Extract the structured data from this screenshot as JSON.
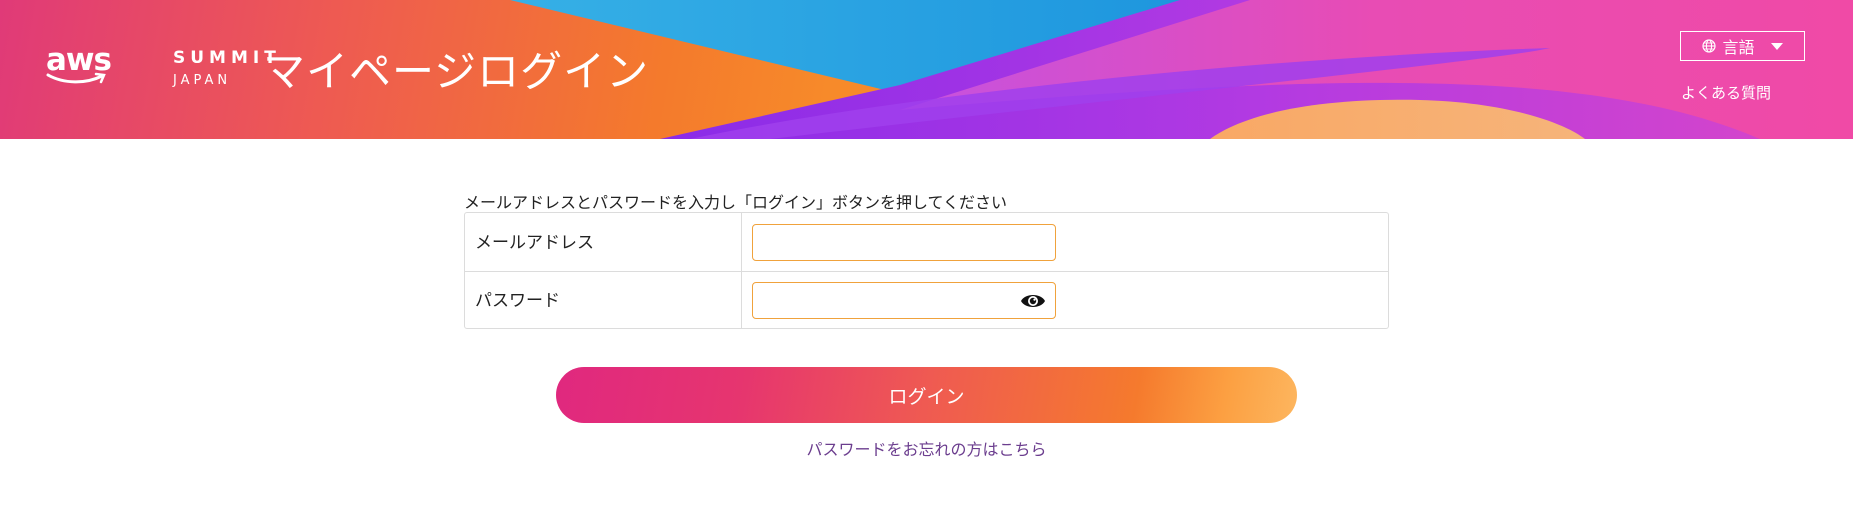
{
  "header": {
    "logo": {
      "aws": "aws",
      "summit": "SUMMIT",
      "japan": "JAPAN"
    },
    "title": "マイページログイン",
    "language_button": {
      "label": "言語",
      "icon": "globe-icon"
    },
    "faq_link": "よくある質問"
  },
  "login_form": {
    "instruction": "メールアドレスとパスワードを入力し「ログイン」ボタンを押してください",
    "email": {
      "label": "メールアドレス",
      "value": "",
      "placeholder": ""
    },
    "password": {
      "label": "パスワード",
      "value": "",
      "placeholder": "",
      "toggle_icon": "eye-icon"
    },
    "submit_label": "ログイン",
    "forgot_password_link": "パスワードをお忘れの方はこちら"
  },
  "colors": {
    "input_border": "#f0a23c",
    "link": "#6b3d8e",
    "button_gradient_start": "#e0287f",
    "button_gradient_end": "#fdb65f"
  }
}
